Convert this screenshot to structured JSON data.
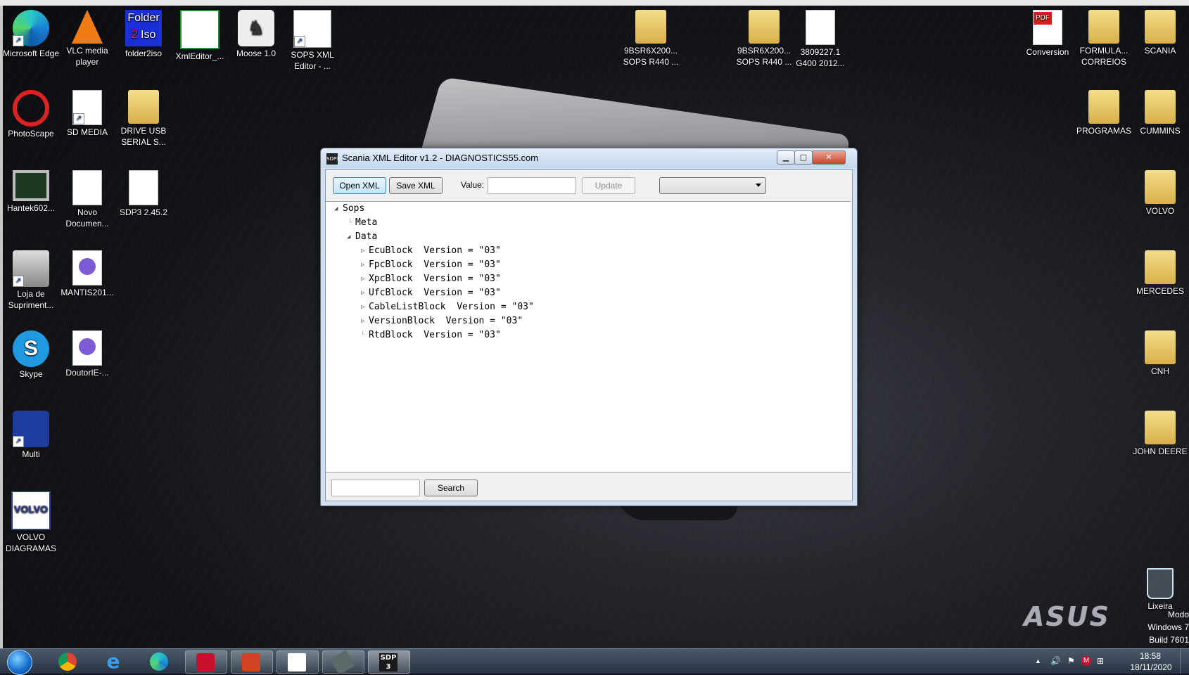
{
  "desktop_icons_left": [
    {
      "label": "Microsoft Edge",
      "icon": "edge-icon"
    },
    {
      "label": "VLC media player",
      "icon": "vlc-icon"
    },
    {
      "label": "folder2iso",
      "icon": "folder2iso-icon",
      "icon_text_1": "Folder",
      "icon_text_2": "2",
      "icon_text_3": "Iso"
    },
    {
      "label": "XmlEditor_...",
      "icon": "xml-editor-icon"
    },
    {
      "label": "Moose 1.0",
      "icon": "moose-icon"
    },
    {
      "label": "SOPS XML Editor - ...",
      "icon": "sops-xml-icon"
    },
    {
      "label": "PhotoScape",
      "icon": "photoscape-icon"
    },
    {
      "label": "SD MEDIA",
      "icon": "document-icon"
    },
    {
      "label": "DRIVE USB SERIAL S...",
      "icon": "pdf-folder-icon"
    },
    {
      "label": "Hantek602...",
      "icon": "monitor-icon"
    },
    {
      "label": "Novo Documen...",
      "icon": "document-icon"
    },
    {
      "label": "SDP3 2.45.2",
      "icon": "document-icon"
    },
    {
      "label": "Loja de Supriment...",
      "icon": "printer-icon"
    },
    {
      "label": "MANTIS201...",
      "icon": "torrent-icon"
    },
    {
      "label": "Skype",
      "icon": "skype-icon",
      "icon_text": "S"
    },
    {
      "label": "DoutorIE-...",
      "icon": "torrent-icon"
    },
    {
      "label": "Multi",
      "icon": "multi-icon"
    },
    {
      "label": "VOLVO DIAGRAMAS",
      "icon": "volvo-icon",
      "icon_text": "VOLVO"
    }
  ],
  "desktop_icons_mid": [
    {
      "label": "9BSR6X200... SOPS R440 ...",
      "icon": "folder-icon"
    },
    {
      "label": "9BSR6X200... SOPS R440 ...",
      "icon": "folder-icon"
    },
    {
      "label": "3809227.1 G400 2012...",
      "icon": "document-icon"
    }
  ],
  "desktop_icons_right": [
    {
      "label": "Conversion",
      "icon": "pdf-icon",
      "icon_text": "PDF"
    },
    {
      "label": "FORMULA... CORREIOS",
      "icon": "folder-icon"
    },
    {
      "label": "SCANIA",
      "icon": "folder-icon"
    },
    {
      "label": "PROGRAMAS",
      "icon": "folder-icon"
    },
    {
      "label": "CUMMINS",
      "icon": "folder-icon"
    },
    {
      "label": "VOLVO",
      "icon": "folder-icon"
    },
    {
      "label": "MERCEDES",
      "icon": "folder-icon"
    },
    {
      "label": "CNH",
      "icon": "folder-icon"
    },
    {
      "label": "JOHN DEERE",
      "icon": "folder-icon"
    },
    {
      "label": "Lixeira",
      "icon": "recycle-bin-icon"
    }
  ],
  "window": {
    "title": "Scania XML Editor v1.2 - DIAGNOSTICS55.com",
    "app_icon_text": "SDP3",
    "min_glyph": "▁",
    "max_glyph": "□",
    "close_glyph": "✕",
    "toolbar": {
      "open_label": "Open XML",
      "save_label": "Save XML",
      "value_label": "Value:",
      "value_input": "",
      "update_label": "Update",
      "dropdown_value": ""
    },
    "tree": {
      "root": "Sops",
      "meta": "Meta",
      "data": "Data",
      "blocks": [
        "EcuBlock  Version = \"03\"",
        "FpcBlock  Version = \"03\"",
        "XpcBlock  Version = \"03\"",
        "UfcBlock  Version = \"03\"",
        "CableListBlock  Version = \"03\"",
        "VersionBlock  Version = \"03\"",
        "RtdBlock  Version = \"03\""
      ]
    },
    "search": {
      "input": "",
      "button_label": "Search"
    }
  },
  "taskbar": {
    "pinned": [
      "start-orb",
      "chrome-icon",
      "internet-explorer-icon",
      "edge-icon",
      "mcafee-icon",
      "powerpoint-icon",
      "sops-xml-icon",
      "usb-tool-icon",
      "sdp3-icon"
    ],
    "sdp_text": "SDP 3",
    "ie_glyph": "e",
    "clock_time": "18:58",
    "clock_date": "18/11/2020",
    "tray_up": "▲",
    "tray_volume": "🔊",
    "tray_flag": "⚑",
    "tray_mcafee": "M",
    "tray_network": "⊞"
  },
  "watermark": {
    "brand": "ASUS",
    "line1": "Modo",
    "line2": "Windows 7",
    "line3": "Build 7601"
  },
  "colors": {
    "window_frame": "#cfe0f2",
    "close_button": "#c6452c",
    "taskbar": "#263241"
  }
}
